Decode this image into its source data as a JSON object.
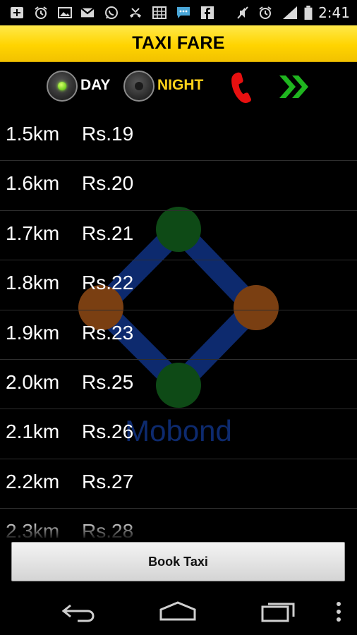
{
  "status_bar": {
    "time": "2:41",
    "left_icons": [
      "add-icon",
      "alarm-icon",
      "image-icon",
      "gmail-icon",
      "whatsapp-icon",
      "missed-call-icon",
      "calendar-grid-icon",
      "message-icon",
      "facebook-icon"
    ],
    "right_icons": [
      "mute-icon",
      "alarm-icon",
      "signal-icon",
      "battery-icon"
    ]
  },
  "header": {
    "title": "TAXI FARE"
  },
  "controls": {
    "day_label": "DAY",
    "night_label": "NIGHT",
    "selected": "day",
    "call_icon": "phone-icon",
    "next_icon": "double-chevron-right-icon"
  },
  "fares": [
    {
      "km": "1.5km",
      "fare": "Rs.19"
    },
    {
      "km": "1.6km",
      "fare": "Rs.20"
    },
    {
      "km": "1.7km",
      "fare": "Rs.21"
    },
    {
      "km": "1.8km",
      "fare": "Rs.22"
    },
    {
      "km": "1.9km",
      "fare": "Rs.23"
    },
    {
      "km": "2.0km",
      "fare": "Rs.25"
    },
    {
      "km": "2.1km",
      "fare": "Rs.26"
    },
    {
      "km": "2.2km",
      "fare": "Rs.27"
    },
    {
      "km": "2.3km",
      "fare": "Rs.28"
    }
  ],
  "watermark": {
    "text": "Mobond"
  },
  "book_button": {
    "label": "Book Taxi"
  },
  "nav_bar": {
    "icons": [
      "back-icon",
      "home-icon",
      "recent-apps-icon",
      "overflow-menu-icon"
    ]
  },
  "colors": {
    "header_yellow": "#ffd400",
    "night_label": "#ffd21a",
    "call_red": "#e81010",
    "next_green": "#1fb51f"
  }
}
